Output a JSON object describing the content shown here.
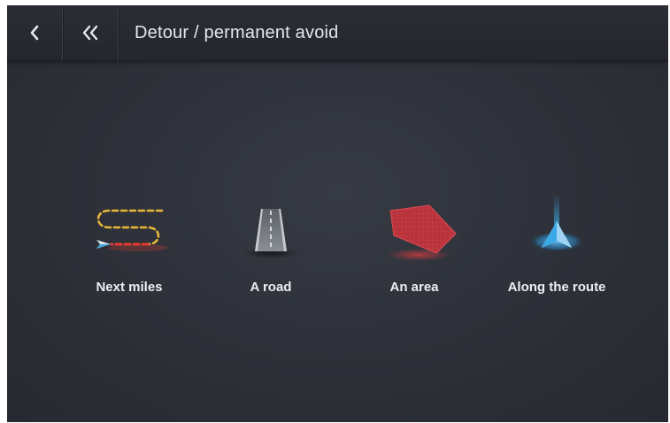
{
  "header": {
    "back_icon": "chevron-left-icon",
    "home_icon": "double-chevron-left-icon",
    "title": "Detour / permanent avoid"
  },
  "options": [
    {
      "label": "Next miles",
      "icon": "winding-route-icon"
    },
    {
      "label": "A road",
      "icon": "road-icon"
    },
    {
      "label": "An area",
      "icon": "area-polygon-icon"
    },
    {
      "label": "Along the route",
      "icon": "navigation-arrow-icon"
    }
  ],
  "colors": {
    "background": "#2d3038",
    "header": "#26292e",
    "text": "#e6e7ea",
    "route_yellow": "#e8b63a",
    "route_red": "#e53a2e",
    "area_red": "#c9363f",
    "nav_blue": "#3aa9e8"
  }
}
